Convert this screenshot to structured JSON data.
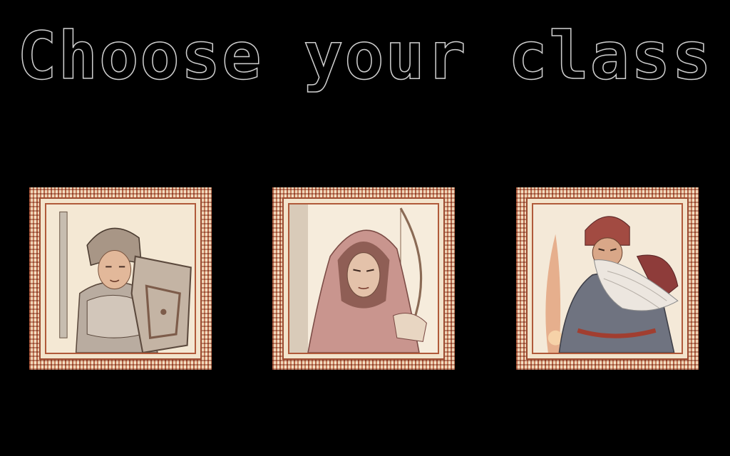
{
  "screen": {
    "title": "Choose your class",
    "classes": [
      {
        "id": "warrior",
        "icon": "armored-knight-portrait"
      },
      {
        "id": "archer",
        "icon": "hooded-archer-portrait"
      },
      {
        "id": "mage",
        "icon": "bearded-wizard-portrait"
      }
    ]
  },
  "colors": {
    "background": "#000000",
    "title_outline": "#cfcfcf",
    "frame_primary": "#c9805f",
    "frame_dark": "#9c4a2f",
    "mat": "#f3e4cc"
  }
}
